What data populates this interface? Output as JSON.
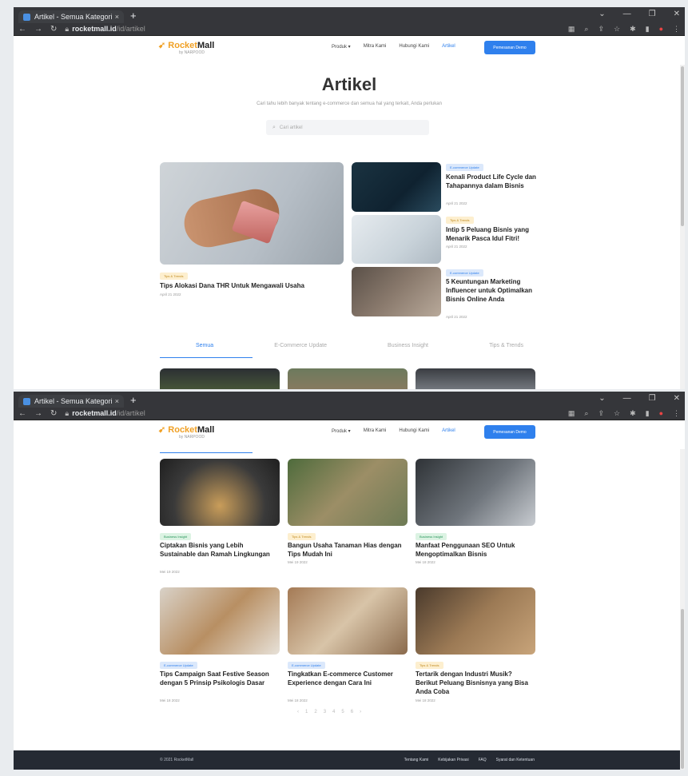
{
  "browser": {
    "tab_title": "Artikel - Semua Kategori",
    "tab_close": "×",
    "new_tab": "+",
    "url_host": "rocketmall.id",
    "url_path": "/id/artikel"
  },
  "site": {
    "logo_part1": "Rocket",
    "logo_part2": "Mall",
    "logo_sub": "by NARPOOD",
    "nav": [
      "Produk ▾",
      "Mitra Kami",
      "Hubungi Kami",
      "Artikel"
    ],
    "cta": "Pemesanan Demo"
  },
  "hero": {
    "title": "Artikel",
    "subtitle": "Cari tahu lebih banyak tentang e-commerce dan semua hal yang terkait, Anda perlukan",
    "search_placeholder": "Cari artikel"
  },
  "featured": {
    "main": {
      "badge": "Tips & Trends",
      "title": "Tips Alokasi Dana THR Untuk Mengawali Usaha",
      "date": "April 21 2022"
    },
    "side": [
      {
        "badge": "E-commerce Update",
        "title": "Kenali Product Life Cycle dan Tahapannya dalam Bisnis",
        "date": "April 21 2022"
      },
      {
        "badge": "Tips & Trends",
        "title": "Intip 5 Peluang Bisnis yang Menarik Pasca Idul Fitri!",
        "date": "April 21 2022"
      },
      {
        "badge": "E-commerce Update",
        "title": "5 Keuntungan Marketing Influencer untuk Optimalkan Bisnis Online Anda",
        "date": "April 21 2022"
      }
    ]
  },
  "category_tabs": [
    "Semua",
    "E-Commerce Update",
    "Business Insight",
    "Tips & Trends"
  ],
  "articles": [
    {
      "badge": "Business Insight",
      "title": "Ciptakan Bisnis yang Lebih Sustainable dan Ramah Lingkungan",
      "date": "Mei 19 2022"
    },
    {
      "badge": "Tips & Trends",
      "title": "Bangun Usaha Tanaman Hias dengan Tips Mudah Ini",
      "date": "Mei 19 2022"
    },
    {
      "badge": "Business Insight",
      "title": "Manfaat Penggunaan SEO Untuk Mengoptimalkan Bisnis",
      "date": "Mei 18 2022"
    },
    {
      "badge": "E-commerce Update",
      "title": "Tips Campaign Saat Festive Season dengan 5 Prinsip Psikologis Dasar",
      "date": "Mei 18 2022"
    },
    {
      "badge": "E-commerce Update",
      "title": "Tingkatkan E-commerce Customer Experience dengan Cara Ini",
      "date": "Mei 18 2022"
    },
    {
      "badge": "Tips & Trends",
      "title": "Tertarik dengan Industri Musik? Berikut Peluang Bisnisnya yang Bisa Anda Coba",
      "date": "Mei 18 2022"
    }
  ],
  "pagination": [
    "‹",
    "1",
    "2",
    "3",
    "4",
    "5",
    "6",
    "›"
  ],
  "footer": {
    "copyright": "© 2021 RocketMall",
    "links": [
      "Tentang Kami",
      "Kebijakan Privasi",
      "FAQ",
      "Syarat dan Ketentuan"
    ]
  },
  "colors": {
    "accent": "#2f80ed",
    "brand_orange": "#f0a024",
    "footer_bg": "#252a33"
  }
}
